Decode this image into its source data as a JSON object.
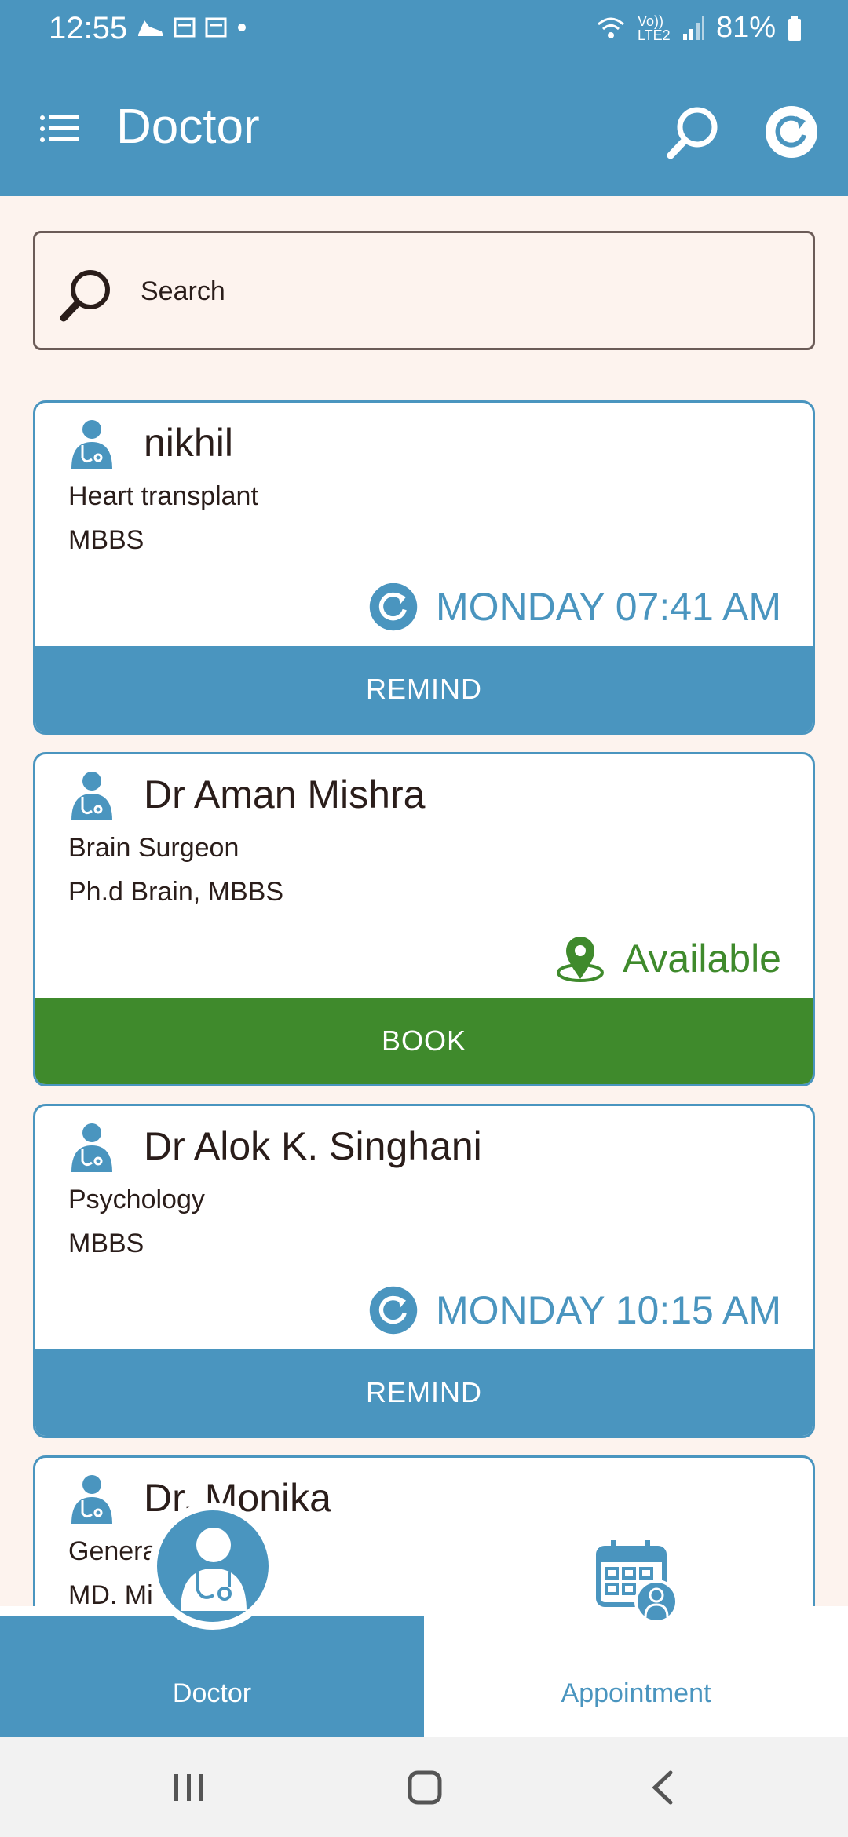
{
  "status_bar": {
    "time": "12:55",
    "network": "Vo)) LTE2",
    "battery": "81%"
  },
  "app_bar": {
    "title": "Doctor",
    "icons": [
      "menu-icon",
      "search-icon",
      "refresh-icon"
    ]
  },
  "search": {
    "placeholder": "Search",
    "value": ""
  },
  "doctors": [
    {
      "name": "nikhil",
      "specialty": "Heart transplant",
      "qualification": "MBBS",
      "status_text": "MONDAY 07:41 AM",
      "status_icon": "refresh-icon",
      "action": "REMIND"
    },
    {
      "name": "Dr Aman Mishra",
      "specialty": "Brain Surgeon",
      "qualification": "Ph.d Brain, MBBS",
      "status_text": "Available",
      "status_icon": "location-pin-icon",
      "action": "BOOK"
    },
    {
      "name": "Dr Alok K. Singhani",
      "specialty": "Psychology",
      "qualification": "MBBS",
      "status_text": "MONDAY 10:15 AM",
      "status_icon": "refresh-icon",
      "action": "REMIND"
    },
    {
      "name": "Dr. Monika",
      "specialty": "Genera",
      "qualification": "MD. Mi"
    }
  ],
  "bottom_nav": {
    "tabs": [
      {
        "label": "Doctor",
        "icon": "doctor-icon",
        "active": true
      },
      {
        "label": "Appointment",
        "icon": "calendar-doctor-icon",
        "active": false
      }
    ]
  },
  "colors": {
    "primary": "#4a95bf",
    "success": "#3f8a2c",
    "background": "#fdf3ee"
  }
}
